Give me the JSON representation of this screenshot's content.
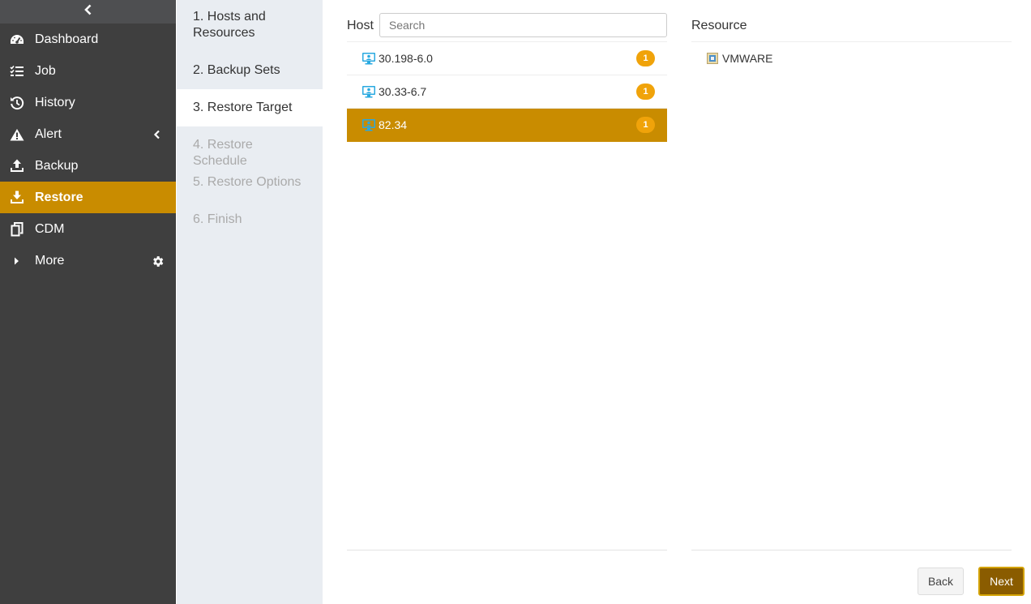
{
  "sidebar": {
    "items": [
      {
        "label": "Dashboard",
        "icon": "dashboard-icon"
      },
      {
        "label": "Job",
        "icon": "job-list-icon"
      },
      {
        "label": "History",
        "icon": "history-icon"
      },
      {
        "label": "Alert",
        "icon": "alert-icon"
      },
      {
        "label": "Backup",
        "icon": "backup-icon"
      },
      {
        "label": "Restore",
        "icon": "restore-icon",
        "active": true
      },
      {
        "label": "CDM",
        "icon": "cdm-icon"
      },
      {
        "label": "More",
        "icon": "caret-right-icon"
      }
    ]
  },
  "steps": [
    {
      "label": "1. Hosts and Resources",
      "state": "done"
    },
    {
      "label": "2. Backup Sets",
      "state": "done"
    },
    {
      "label": "3. Restore Target",
      "state": "current"
    },
    {
      "label": "4. Restore Schedule",
      "state": "disabled"
    },
    {
      "label": "5. Restore Options",
      "state": "disabled"
    },
    {
      "label": "6. Finish",
      "state": "disabled"
    }
  ],
  "host": {
    "title": "Host",
    "search_placeholder": "Search",
    "rows": [
      {
        "name": "30.198-6.0",
        "count": "1"
      },
      {
        "name": "30.33-6.7",
        "count": "1"
      },
      {
        "name": "82.34",
        "count": "1",
        "selected": true
      }
    ]
  },
  "resource": {
    "title": "Resource",
    "items": [
      {
        "name": "VMWARE",
        "icon": "vmware-icon"
      }
    ]
  },
  "buttons": {
    "back": "Back",
    "next": "Next"
  },
  "colors": {
    "accent": "#c98c00",
    "sidebar_bg": "#3f3f3f",
    "badge": "#f0a30a",
    "next_button": "#8a5c00"
  }
}
